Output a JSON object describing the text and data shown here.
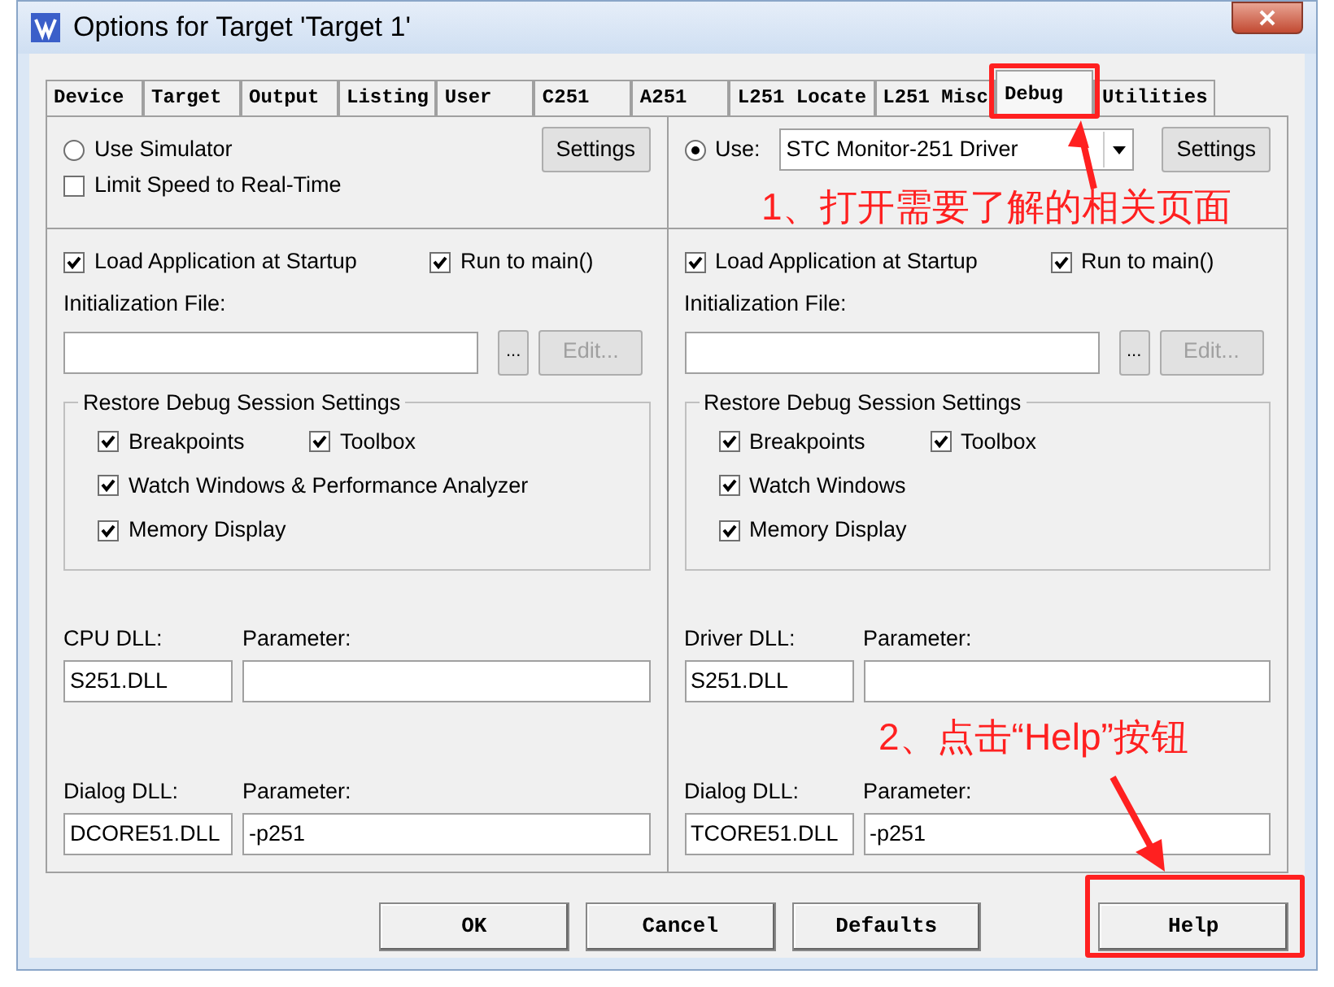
{
  "window": {
    "title": "Options for Target 'Target 1'"
  },
  "tabs": [
    {
      "label": "Device",
      "selected": false
    },
    {
      "label": "Target",
      "selected": false
    },
    {
      "label": "Output",
      "selected": false
    },
    {
      "label": "Listing",
      "selected": false
    },
    {
      "label": "User",
      "selected": false
    },
    {
      "label": "C251",
      "selected": false
    },
    {
      "label": "A251",
      "selected": false
    },
    {
      "label": "L251 Locate",
      "selected": false
    },
    {
      "label": "L251 Misc",
      "selected": false
    },
    {
      "label": "Debug",
      "selected": true
    },
    {
      "label": "Utilities",
      "selected": false
    }
  ],
  "panels": [
    {
      "mode": {
        "kind": "radio",
        "label": "Use Simulator",
        "selected": false
      },
      "settings": "Settings",
      "limit_speed": {
        "label": "Limit Speed to Real-Time",
        "checked": false
      },
      "load_app": {
        "label": "Load Application at Startup",
        "checked": true
      },
      "run_to_main": {
        "label": "Run to main()",
        "checked": true
      },
      "init_label": "Initialization File:",
      "browse": "...",
      "edit": {
        "label": "Edit...",
        "disabled": true
      },
      "restore": {
        "title": "Restore Debug Session Settings",
        "items": [
          {
            "label": "Breakpoints",
            "checked": true
          },
          {
            "label": "Toolbox",
            "checked": true
          },
          {
            "label": "Watch Windows & Performance Analyzer",
            "checked": true
          },
          {
            "label": "Memory Display",
            "checked": true
          }
        ]
      },
      "dll_rows": [
        {
          "label": "CPU DLL:",
          "value": "S251.DLL",
          "param_label": "Parameter:"
        },
        {
          "label": "Dialog DLL:",
          "value": "DCORE51.DLL",
          "param_label": "Parameter:",
          "param": "-p251"
        }
      ]
    },
    {
      "mode": {
        "kind": "dropdown",
        "label": "Use:",
        "selected": true,
        "value": "STC Monitor-251 Driver"
      },
      "settings": "Settings",
      "load_app": {
        "label": "Load Application at Startup",
        "checked": true
      },
      "run_to_main": {
        "label": "Run to main()",
        "checked": true
      },
      "init_label": "Initialization File:",
      "browse": "...",
      "edit": {
        "label": "Edit...",
        "disabled": true
      },
      "restore": {
        "title": "Restore Debug Session Settings",
        "items": [
          {
            "label": "Breakpoints",
            "checked": true
          },
          {
            "label": "Toolbox",
            "checked": true
          },
          {
            "label": "Watch Windows",
            "checked": true
          },
          {
            "label": "Memory Display",
            "checked": true
          }
        ]
      },
      "dll_rows": [
        {
          "label": "Driver DLL:",
          "value": "S251.DLL",
          "param_label": "Parameter:"
        },
        {
          "label": "Dialog DLL:",
          "value": "TCORE51.DLL",
          "param_label": "Parameter:",
          "param": "-p251"
        }
      ]
    }
  ],
  "buttons": [
    "OK",
    "Cancel",
    "Defaults",
    "Help"
  ],
  "annotations": [
    {
      "text": "1、打开需要了解的相关页面"
    },
    {
      "text": "2、点击“Help”按钮"
    }
  ]
}
